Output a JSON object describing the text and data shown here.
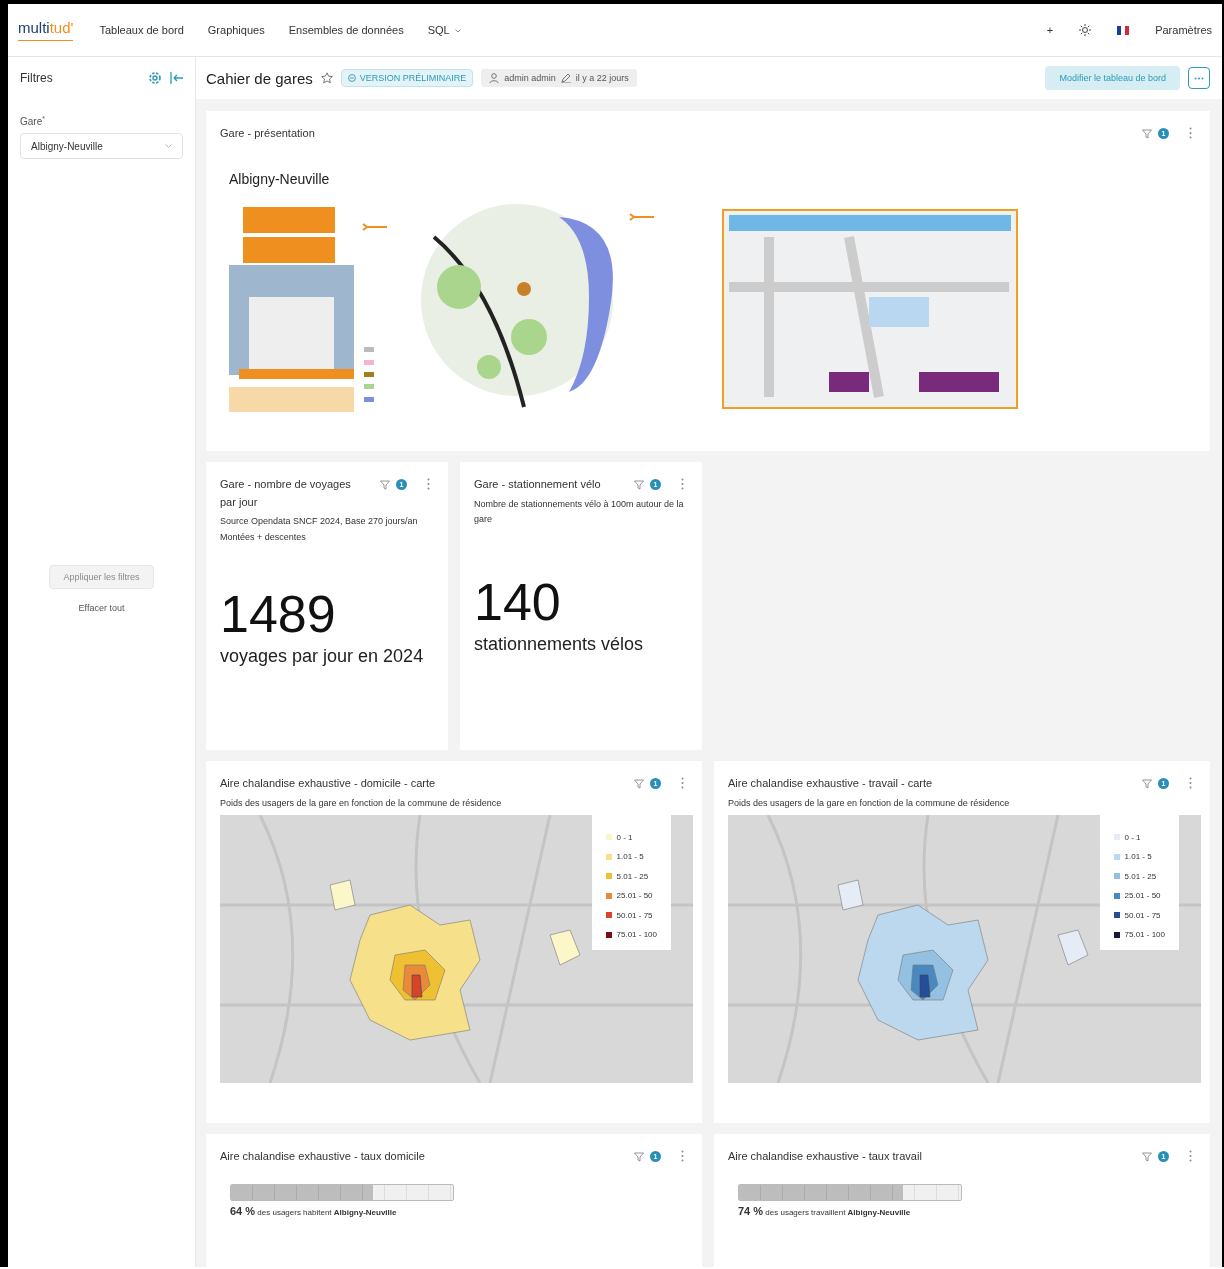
{
  "navbar": {
    "logo": {
      "text": "multi",
      "accent": "tud'"
    },
    "menu": [
      {
        "label": "Tableaux de bord",
        "dropdown": false
      },
      {
        "label": "Graphiques",
        "dropdown": false
      },
      {
        "label": "Ensembles de données",
        "dropdown": false
      },
      {
        "label": "SQL",
        "dropdown": true
      }
    ],
    "add_label": "+",
    "settings_label": "Paramètres"
  },
  "filters": {
    "title": "Filtres",
    "field": {
      "label": "Gare",
      "required_mark": "*",
      "value": "Albigny-Neuville"
    },
    "apply_button": {
      "label": "Appliquer les filtres",
      "disabled": true
    },
    "clear_link": "Effacer tout"
  },
  "dashboard": {
    "title": "Cahier de gares",
    "favorite": false,
    "status": "VERSION PRÉLIMINAIRE",
    "owner": "admin admin",
    "modified": "il y a 22 jours",
    "edit_button": "Modifier le tableau de bord"
  },
  "cards": [
    {
      "kind": "presentation",
      "title": "Gare - présentation",
      "filter_count": "1",
      "heading": "Albigny-Neuville"
    },
    {
      "kind": "big_number",
      "title": "Gare - nombre de voyages par jour",
      "filter_count": "1",
      "subtitle": "Source Opendata SNCF 2024, Base 270 jours/an Montées + descentes",
      "value": "1489",
      "unit": "voyages par jour en 2024"
    },
    {
      "kind": "big_number",
      "title": "Gare - stationnement vélo",
      "filter_count": "1",
      "subtitle": "Nombre de stationnements vélo à 100m autour de la gare",
      "value": "140",
      "unit": "stationnements vélos"
    },
    {
      "kind": "map",
      "title": "Aire chalandise exhaustive - domicile - carte",
      "filter_count": "1",
      "subtitle": "Poids des usagers de la gare en fonction de la commune de résidence",
      "legend": [
        {
          "label": "0 - 1",
          "color": "#fbf7c8"
        },
        {
          "label": "1.01 - 5",
          "color": "#f6e08a"
        },
        {
          "label": "5.01 - 25",
          "color": "#eec032"
        },
        {
          "label": "25.01 - 50",
          "color": "#e88a3a"
        },
        {
          "label": "50.01 - 75",
          "color": "#d4452a"
        },
        {
          "label": "75.01 - 100",
          "color": "#7a0c12"
        }
      ]
    },
    {
      "kind": "map",
      "title": "Aire chalandise exhaustive - travail - carte",
      "filter_count": "1",
      "subtitle": "Poids des usagers de la gare en fonction de la commune de résidence",
      "legend": [
        {
          "label": "0 - 1",
          "color": "#e6ecf6"
        },
        {
          "label": "1.01 - 5",
          "color": "#bcd8ee"
        },
        {
          "label": "5.01 - 25",
          "color": "#94c0e2"
        },
        {
          "label": "25.01 - 50",
          "color": "#4a88c0"
        },
        {
          "label": "50.01 - 75",
          "color": "#244e98"
        },
        {
          "label": "75.01 - 100",
          "color": "#161a36"
        }
      ]
    },
    {
      "kind": "progress",
      "title": "Aire chalandise exhaustive - taux domicile",
      "filter_count": "1",
      "level": 0.64,
      "value": "64 %",
      "text": "des usagers habitent **Albigny-Neuville**"
    },
    {
      "kind": "progress",
      "title": "Aire chalandise exhaustive - taux travail",
      "filter_count": "1",
      "level": 0.74,
      "value": "74 %",
      "text": "des usagers travaillent **Albigny-Neuville**"
    }
  ]
}
